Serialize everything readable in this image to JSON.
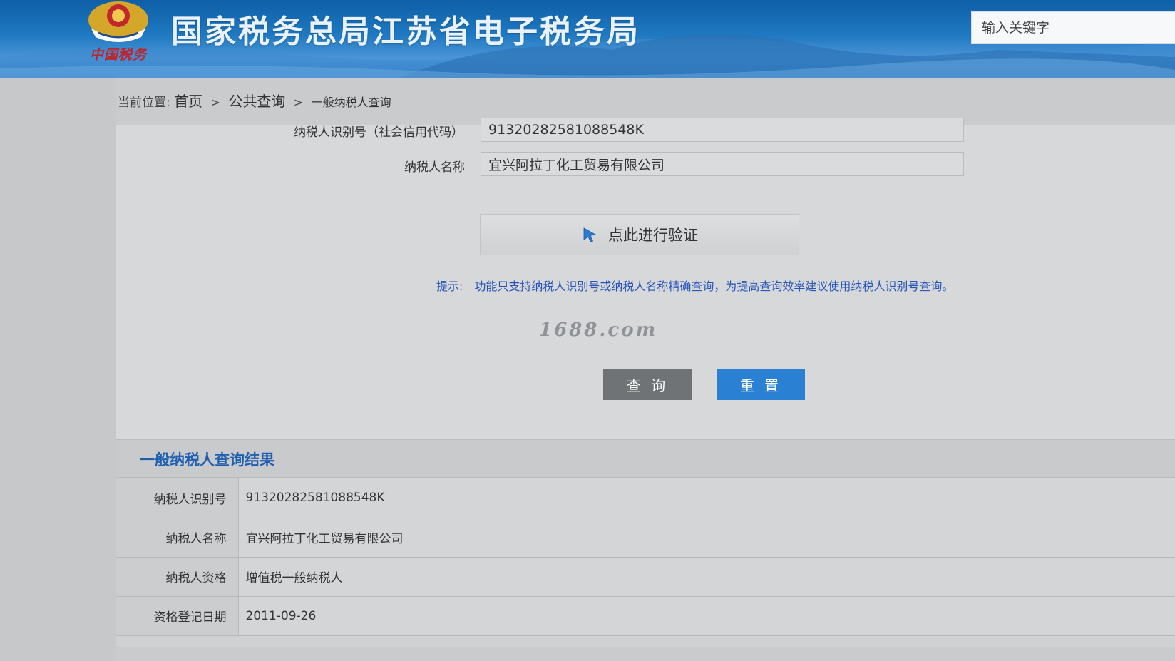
{
  "header": {
    "site_title": "国家税务总局江苏省电子税务局",
    "emblem_text": "中国税务",
    "search_placeholder": "输入关键字"
  },
  "breadcrumb": {
    "prefix": "当前位置:",
    "items": [
      "首页",
      "公共查询"
    ],
    "current": "一般纳税人查询",
    "separator": ">"
  },
  "form": {
    "taxpayer_id_label": "纳税人识别号（社会信用代码）",
    "taxpayer_id_value": "91320282581088548K",
    "taxpayer_name_label": "纳税人名称",
    "taxpayer_name_value": "宜兴阿拉丁化工贸易有限公司",
    "verify_label": "点此进行验证",
    "hint_prefix": "提示:",
    "hint_text": "功能只支持纳税人识别号或纳税人名称精确查询，为提高查询效率建议使用纳税人识别号查询。",
    "watermark": "1688.com",
    "query_button": "查 询",
    "reset_button": "重 置"
  },
  "result": {
    "title": "一般纳税人查询结果",
    "rows": [
      {
        "label": "纳税人识别号",
        "value": "91320282581088548K"
      },
      {
        "label": "纳税人名称",
        "value": "宜兴阿拉丁化工贸易有限公司"
      },
      {
        "label": "纳税人资格",
        "value": "增值税一般纳税人"
      },
      {
        "label": "资格登记日期",
        "value": "2011-09-26"
      }
    ]
  },
  "colors": {
    "header_blue": "#1f79c2",
    "link_blue": "#2855b8",
    "reset_button": "#2a80d2",
    "query_button": "#6f7376"
  }
}
